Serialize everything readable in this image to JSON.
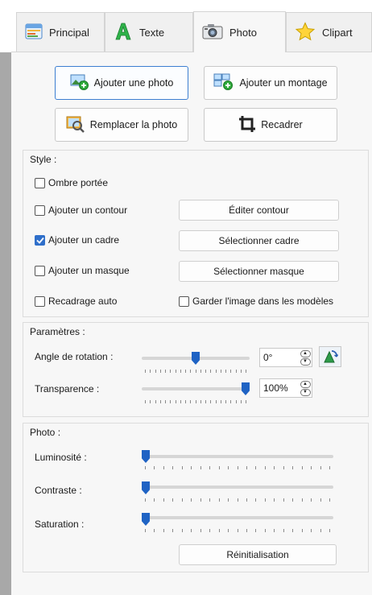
{
  "tabs": [
    {
      "label": "Principal",
      "icon": "table-icon",
      "active": false
    },
    {
      "label": "Texte",
      "icon": "letter-a-icon",
      "active": false
    },
    {
      "label": "Photo",
      "icon": "camera-icon",
      "active": true
    },
    {
      "label": "Clipart",
      "icon": "star-icon",
      "active": false
    }
  ],
  "actions": {
    "add_photo": "Ajouter une photo",
    "add_montage": "Ajouter un montage",
    "replace_photo": "Remplacer la photo",
    "crop": "Recadrer"
  },
  "style": {
    "title": "Style :",
    "drop_shadow": {
      "label": "Ombre portée",
      "checked": false
    },
    "add_outline": {
      "label": "Ajouter un contour",
      "checked": false
    },
    "edit_outline": "Éditer contour",
    "add_frame": {
      "label": "Ajouter un cadre",
      "checked": true
    },
    "select_frame": "Sélectionner cadre",
    "add_mask": {
      "label": "Ajouter un masque",
      "checked": false
    },
    "select_mask": "Sélectionner masque",
    "auto_crop": {
      "label": "Recadrage auto",
      "checked": false
    },
    "keep_in_templates": {
      "label": "Garder l'image dans les modèles",
      "checked": false
    }
  },
  "params": {
    "title": "Paramètres :",
    "rotation": {
      "label": "Angle de rotation :",
      "value": "0°",
      "level": 0.5
    },
    "transparency": {
      "label": "Transparence :",
      "value": "100%",
      "level": 1.0
    }
  },
  "photo": {
    "title": "Photo :",
    "brightness": {
      "label": "Luminosité :",
      "level": 0
    },
    "contrast": {
      "label": "Contraste :",
      "level": 0
    },
    "saturation": {
      "label": "Saturation :",
      "level": 0
    },
    "reset": "Réinitialisation"
  },
  "colors": {
    "accent": "#1f63c4",
    "checked": "#2f6fca"
  }
}
